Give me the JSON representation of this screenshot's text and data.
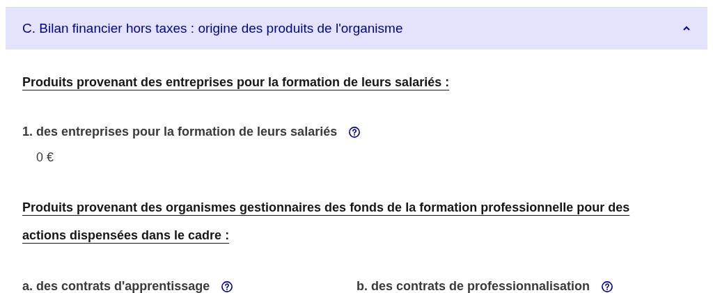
{
  "accordion": {
    "title": "C. Bilan financier hors taxes : origine des produits de l'organisme",
    "expanded": true
  },
  "sections": [
    {
      "heading": "Produits provenant des entreprises pour la formation de leurs salariés :",
      "fields": [
        {
          "label": "1. des entreprises pour la formation de leurs salariés",
          "value": "0 €"
        }
      ]
    },
    {
      "heading": "Produits provenant des organismes gestionnaires des fonds de la formation professionnelle pour des actions dispensées dans le cadre :",
      "fields": [
        {
          "label": "a. des contrats d'apprentissage"
        },
        {
          "label": "b. des contrats de professionnalisation"
        }
      ]
    }
  ]
}
